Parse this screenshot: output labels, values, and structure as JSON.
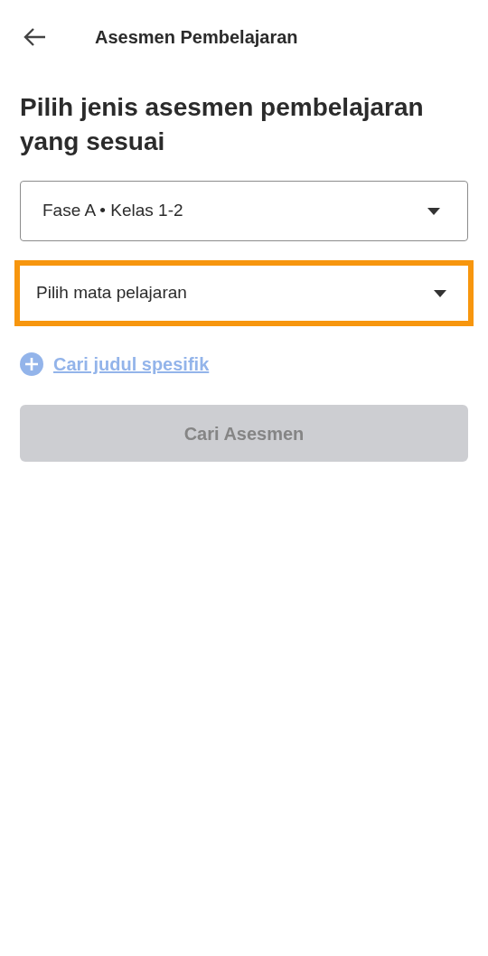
{
  "header": {
    "title": "Asesmen Pembelajaran"
  },
  "heading": "Pilih jenis asesmen pembelajaran yang sesuai",
  "dropdowns": [
    {
      "text": "Fase A • Kelas 1-2",
      "highlighted": false
    },
    {
      "text": "Pilih mata pelajaran",
      "highlighted": true
    }
  ],
  "link": {
    "label": "Cari judul spesifik",
    "disabled": true
  },
  "button": {
    "label": "Cari Asesmen",
    "disabled": true
  }
}
